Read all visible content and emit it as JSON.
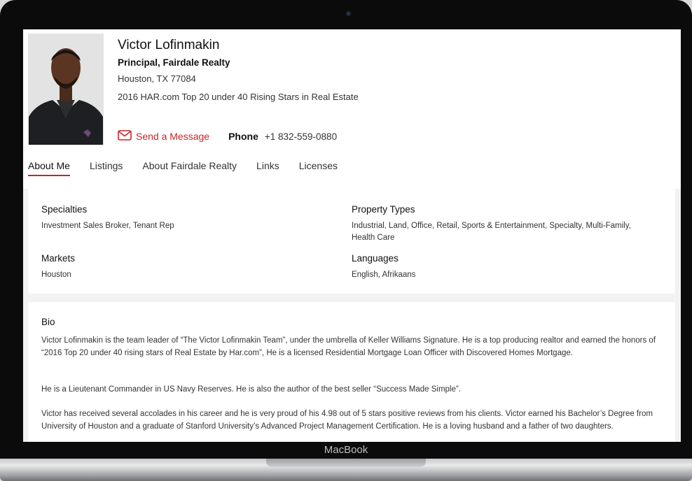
{
  "device": {
    "brand": "MacBook"
  },
  "profile": {
    "name": "Victor Lofinmakin",
    "title": "Principal, Fairdale Realty",
    "location": "Houston, TX 77084",
    "award": "2016 HAR.com Top 20 under 40 Rising Stars in Real Estate",
    "message_label": "Send a Message",
    "phone_label": "Phone",
    "phone_value": "+1 832-559-0880"
  },
  "tabs": [
    {
      "label": "About Me",
      "active": true
    },
    {
      "label": "Listings",
      "active": false
    },
    {
      "label": "About Fairdale Realty",
      "active": false
    },
    {
      "label": "Links",
      "active": false
    },
    {
      "label": "Licenses",
      "active": false
    }
  ],
  "details": {
    "specialties_label": "Specialties",
    "specialties_value": "Investment Sales Broker, Tenant Rep",
    "property_types_label": "Property Types",
    "property_types_value": "Industrial, Land, Office, Retail, Sports & Entertainment, Specialty, Multi-Family, Health Care",
    "markets_label": "Markets",
    "markets_value": "Houston",
    "languages_label": "Languages",
    "languages_value": "English, Afrikaans"
  },
  "bio": {
    "title": "Bio",
    "paragraphs": [
      "Victor Lofinmakin is the team leader of “The Victor Lofinmakin Team”, under the umbrella of Keller Williams Signature. He is a top producing realtor and earned the honors of “2016 Top 20 under 40 rising stars of Real Estate by Har.com”, He is a licensed Residential Mortgage Loan Officer with Discovered Homes Mortgage.",
      "He is a Lieutenant Commander in US Navy Reserves. He is also the author of the best seller “Success Made Simple”.",
      "Victor has received several accolades in his career and he is very proud of his 4.98 out of 5 stars positive reviews from his clients. Victor earned his Bachelor’s Degree from University of Houston and a graduate of Stanford University’s Advanced Project Management Certification. He is a loving husband and a father of two daughters."
    ]
  },
  "colors": {
    "accent": "#c8232c"
  }
}
